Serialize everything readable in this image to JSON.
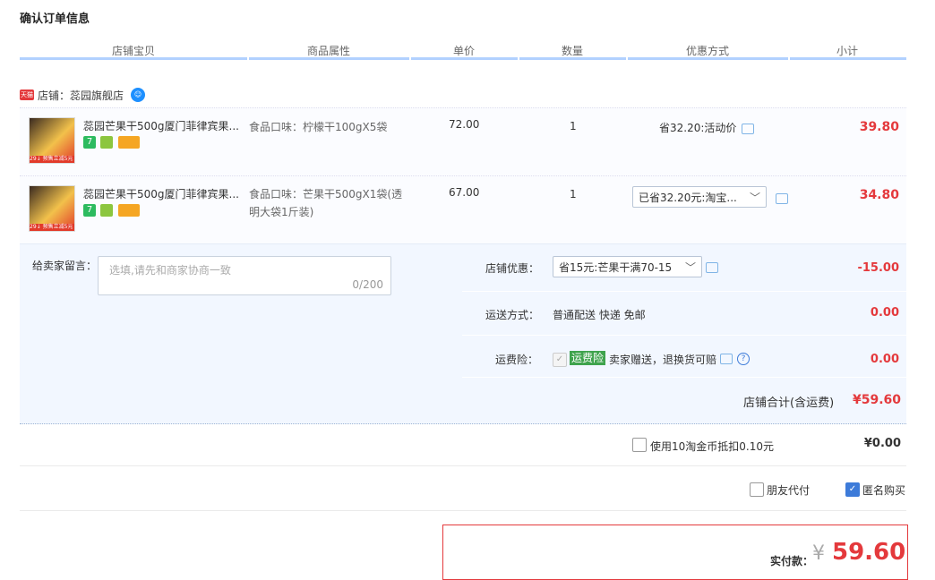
{
  "page": {
    "title": "确认订单信息"
  },
  "table_header": [
    "店铺宝贝",
    "商品属性",
    "单价",
    "数量",
    "优惠方式",
    "小计"
  ],
  "shop": {
    "badge": "天猫",
    "label": "店铺：蕊园旗舰店"
  },
  "items": [
    {
      "thumb_tag": "29↓ 预售立减5元",
      "title": "蕊园芒果干500g厦门菲律宾果...",
      "attr": "食品口味：柠檬干100gX5袋",
      "price": "72.00",
      "qty": "1",
      "discount": "省32.20:活动价",
      "subtotal": "39.80"
    },
    {
      "thumb_tag": "29↓ 预售立减5元",
      "title": "蕊园芒果干500g厦门菲律宾果...",
      "attr": "食品口味：芒果干500gX1袋(透明大袋1斤装)",
      "price": "67.00",
      "qty": "1",
      "discount_select": "已省32.20元:淘宝...",
      "subtotal": "34.80"
    }
  ],
  "message": {
    "label": "给卖家留言：",
    "placeholder": "选填,请先和商家协商一致",
    "count": "0/200"
  },
  "shop_discount": {
    "label": "店铺优惠：",
    "select": "省15元:芒果干满70-15",
    "value": "-15.00"
  },
  "shipping": {
    "label": "运送方式：",
    "text": "普通配送 快递 免邮",
    "value": "0.00"
  },
  "insurance": {
    "label": "运费险：",
    "badge": "运费险",
    "text": "卖家赠送，退换货可赔",
    "value": "0.00"
  },
  "shop_total": {
    "label": "店铺合计(含运费)",
    "value": "¥59.60"
  },
  "coins": {
    "label": "使用10淘金币抵扣0.10元",
    "value": "¥0.00"
  },
  "options": {
    "friend_pay": "朋友代付",
    "anonymous": "匿名购买"
  },
  "payment": {
    "label": "实付款：",
    "currency": "¥",
    "amount": "59.60"
  },
  "colors": {
    "accent": "#e4393c",
    "header_line": "#b2d1ff",
    "panel_bg": "#f2f7ff"
  }
}
